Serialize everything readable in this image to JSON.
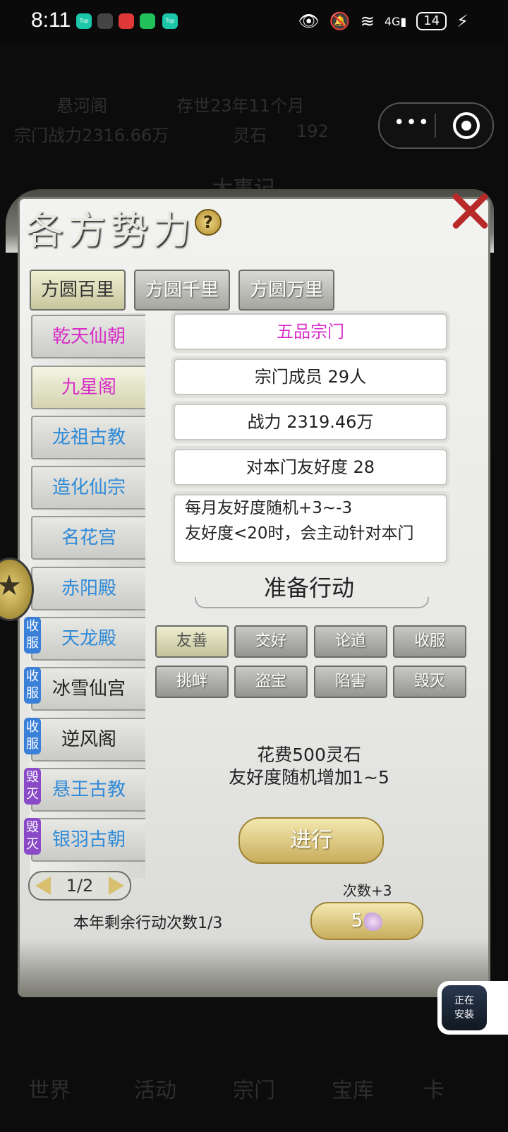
{
  "status_bar": {
    "time": "8:11",
    "app_icons": [
      "Top",
      "",
      "",
      "",
      "Top"
    ],
    "battery": "14",
    "network": "4G"
  },
  "background": {
    "text_rows": [
      "悬河阁",
      "存世23年11个月",
      "宗门战力2316.66万",
      "灵石",
      "192",
      "大事记"
    ],
    "bottom_labels": [
      "世界",
      "活动",
      "宗门",
      "宝库",
      "卡"
    ]
  },
  "capsule": {
    "more_icon": "ellipsis-icon",
    "close_icon": "target-icon"
  },
  "panel": {
    "title": "各方势力",
    "help": "?",
    "tabs": [
      {
        "label": "方圆百里",
        "active": true
      },
      {
        "label": "方圆千里",
        "active": false
      },
      {
        "label": "方圆万里",
        "active": false
      }
    ],
    "sects": [
      {
        "name": "乾天仙朝",
        "color": "#d82cc8",
        "badge": ""
      },
      {
        "name": "九星阁",
        "color": "#d82cc8",
        "badge": "",
        "selected": true
      },
      {
        "name": "龙祖古教",
        "color": "#2e8ad8",
        "badge": ""
      },
      {
        "name": "造化仙宗",
        "color": "#2e8ad8",
        "badge": ""
      },
      {
        "name": "名花宫",
        "color": "#2e8ad8",
        "badge": ""
      },
      {
        "name": "赤阳殿",
        "color": "#2e8ad8",
        "badge": ""
      },
      {
        "name": "天龙殿",
        "color": "#2e8ad8",
        "badge": "收服"
      },
      {
        "name": "冰雪仙宫",
        "color": "#222222",
        "badge": "收服"
      },
      {
        "name": "逆风阁",
        "color": "#222222",
        "badge": "收服"
      },
      {
        "name": "悬王古教",
        "color": "#2e8ad8",
        "badge": "毁灭"
      },
      {
        "name": "银羽古朝",
        "color": "#2e8ad8",
        "badge": "毁灭"
      }
    ],
    "pager": "1/2",
    "info": {
      "rank": "五品宗门",
      "members": "宗门成员 29人",
      "power": "战力 2319.46万",
      "friendship": "对本门友好度 28",
      "desc_line1": "每月友好度随机+3~-3",
      "desc_line2": "友好度<20时，会主动针对本门"
    },
    "section_title": "准备行动",
    "actions": [
      {
        "label": "友善",
        "active": true
      },
      {
        "label": "交好",
        "active": false
      },
      {
        "label": "论道",
        "active": false
      },
      {
        "label": "收服",
        "active": false
      },
      {
        "label": "挑衅",
        "active": false
      },
      {
        "label": "盗宝",
        "active": false
      },
      {
        "label": "陷害",
        "active": false
      },
      {
        "label": "毁灭",
        "active": false
      }
    ],
    "cost_line1": "花费500灵石",
    "cost_line2": "友好度随机增加1~5",
    "go_button": "进行",
    "remaining": "本年剩余行动次数1/3",
    "plus_count": "次数+3",
    "count_button": "5"
  },
  "ad": {
    "line1": "正在",
    "line2": "安装"
  }
}
